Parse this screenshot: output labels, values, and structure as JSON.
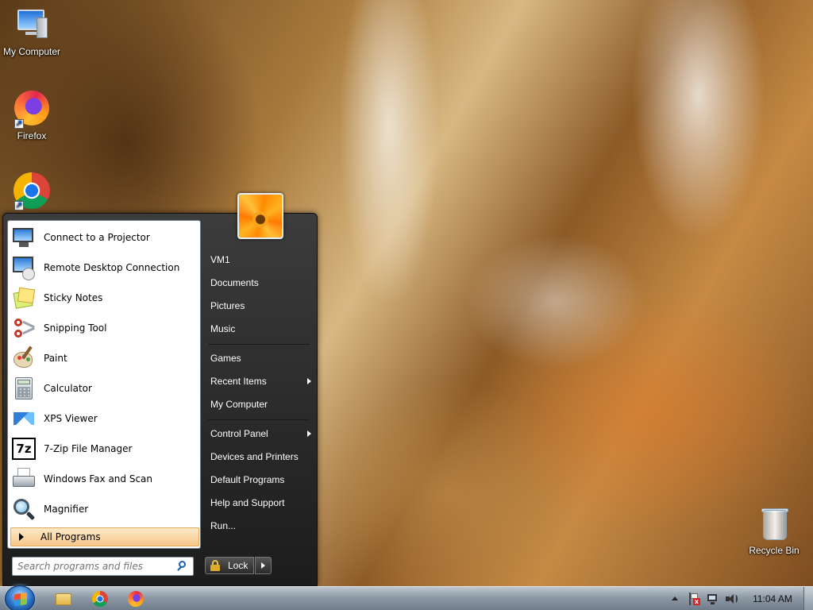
{
  "desktop": {
    "icons": [
      {
        "label": "My Computer",
        "icon": "computer-icon"
      },
      {
        "label": "Firefox",
        "icon": "firefox-icon"
      },
      {
        "label": "",
        "icon": "chrome-icon"
      },
      {
        "label": "Recycle Bin",
        "icon": "recycle-bin-icon"
      }
    ]
  },
  "start_menu": {
    "programs": [
      {
        "label": "Connect to a Projector",
        "icon": "projector-icon"
      },
      {
        "label": "Remote Desktop Connection",
        "icon": "remote-desktop-icon"
      },
      {
        "label": "Sticky Notes",
        "icon": "sticky-notes-icon"
      },
      {
        "label": "Snipping Tool",
        "icon": "scissors-icon"
      },
      {
        "label": "Paint",
        "icon": "paint-palette-icon"
      },
      {
        "label": "Calculator",
        "icon": "calculator-icon"
      },
      {
        "label": "XPS Viewer",
        "icon": "xps-viewer-icon"
      },
      {
        "label": "7-Zip File Manager",
        "icon": "7zip-icon"
      },
      {
        "label": "Windows Fax and Scan",
        "icon": "fax-icon"
      },
      {
        "label": "Magnifier",
        "icon": "magnifier-icon"
      }
    ],
    "all_programs": "All Programs",
    "search_placeholder": "Search programs and files",
    "right_items": [
      {
        "label": "VM1",
        "arrow": false
      },
      {
        "label": "Documents",
        "arrow": false
      },
      {
        "label": "Pictures",
        "arrow": false
      },
      {
        "label": "Music",
        "arrow": false
      },
      {
        "label": "Games",
        "arrow": false
      },
      {
        "label": "Recent Items",
        "arrow": true
      },
      {
        "label": "My Computer",
        "arrow": false
      },
      {
        "label": "Control Panel",
        "arrow": true
      },
      {
        "label": "Devices and Printers",
        "arrow": false
      },
      {
        "label": "Default Programs",
        "arrow": false
      },
      {
        "label": "Help and Support",
        "arrow": false
      },
      {
        "label": "Run...",
        "arrow": false
      }
    ],
    "lock_label": "Lock"
  },
  "taskbar": {
    "pinned": [
      "folder-icon",
      "chrome-icon",
      "firefox-icon"
    ],
    "tray_icons": [
      "show-hidden-icons-arrow",
      "action-center-flag-icon",
      "network-icon",
      "volume-icon"
    ],
    "clock": "11:04 AM"
  },
  "colors": {
    "menu_dark": "#2a2a2a",
    "all_programs_highlight": "#f7c78b",
    "taskbar": "#8e9aa6"
  }
}
